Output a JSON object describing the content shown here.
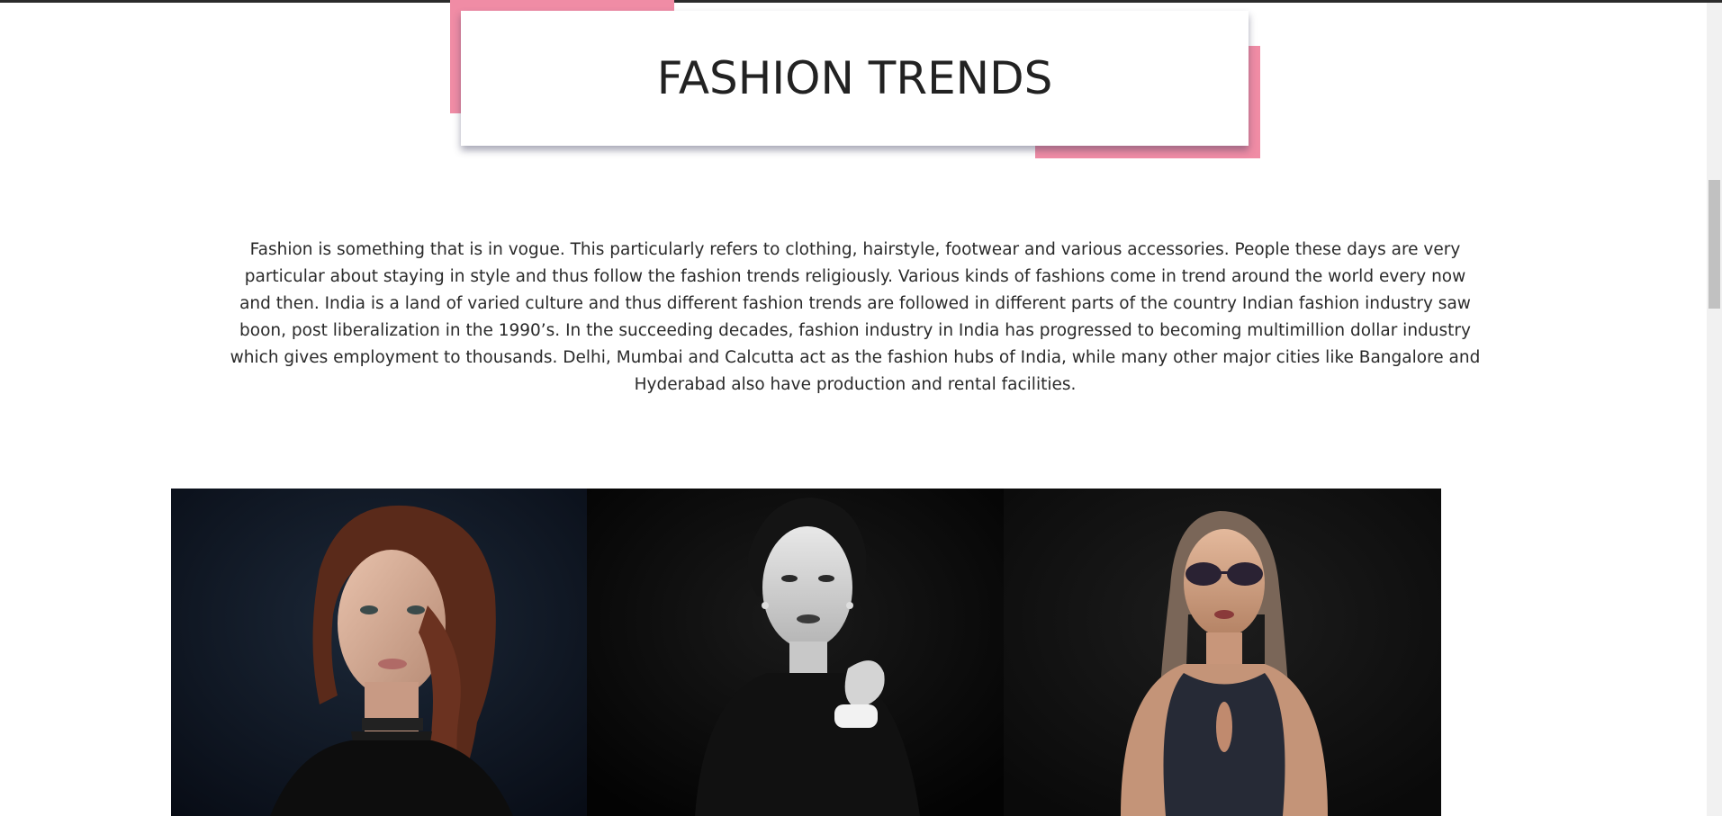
{
  "header": {
    "title": "FASHION TRENDS"
  },
  "intro": {
    "text": "Fashion is something that is in vogue. This particularly refers to clothing, hairstyle, footwear and various accessories. People these days are very particular about staying in style and thus follow the fashion trends religiously. Various kinds of fashions come in trend around the world every now and then. India is a land of varied culture and thus different fashion trends are followed in different parts of the country Indian fashion industry saw boon, post liberalization in the 1990’s. In the succeeding decades, fashion industry in India has progressed to becoming multimillion dollar industry which gives employment to thousands. Delhi, Mumbai and Calcutta act as the fashion hubs of India, while many other major cities like Bangalore and Hyderabad also have production and rental facilities."
  },
  "colors": {
    "accent": "#f08ca5",
    "text": "#222222",
    "background": "#ffffff"
  },
  "gallery": {
    "photos": [
      {
        "subject": "woman-with-braid-and-choker-photo"
      },
      {
        "subject": "black-and-white-portrait-photo"
      },
      {
        "subject": "woman-with-sunglasses-photo"
      }
    ]
  }
}
